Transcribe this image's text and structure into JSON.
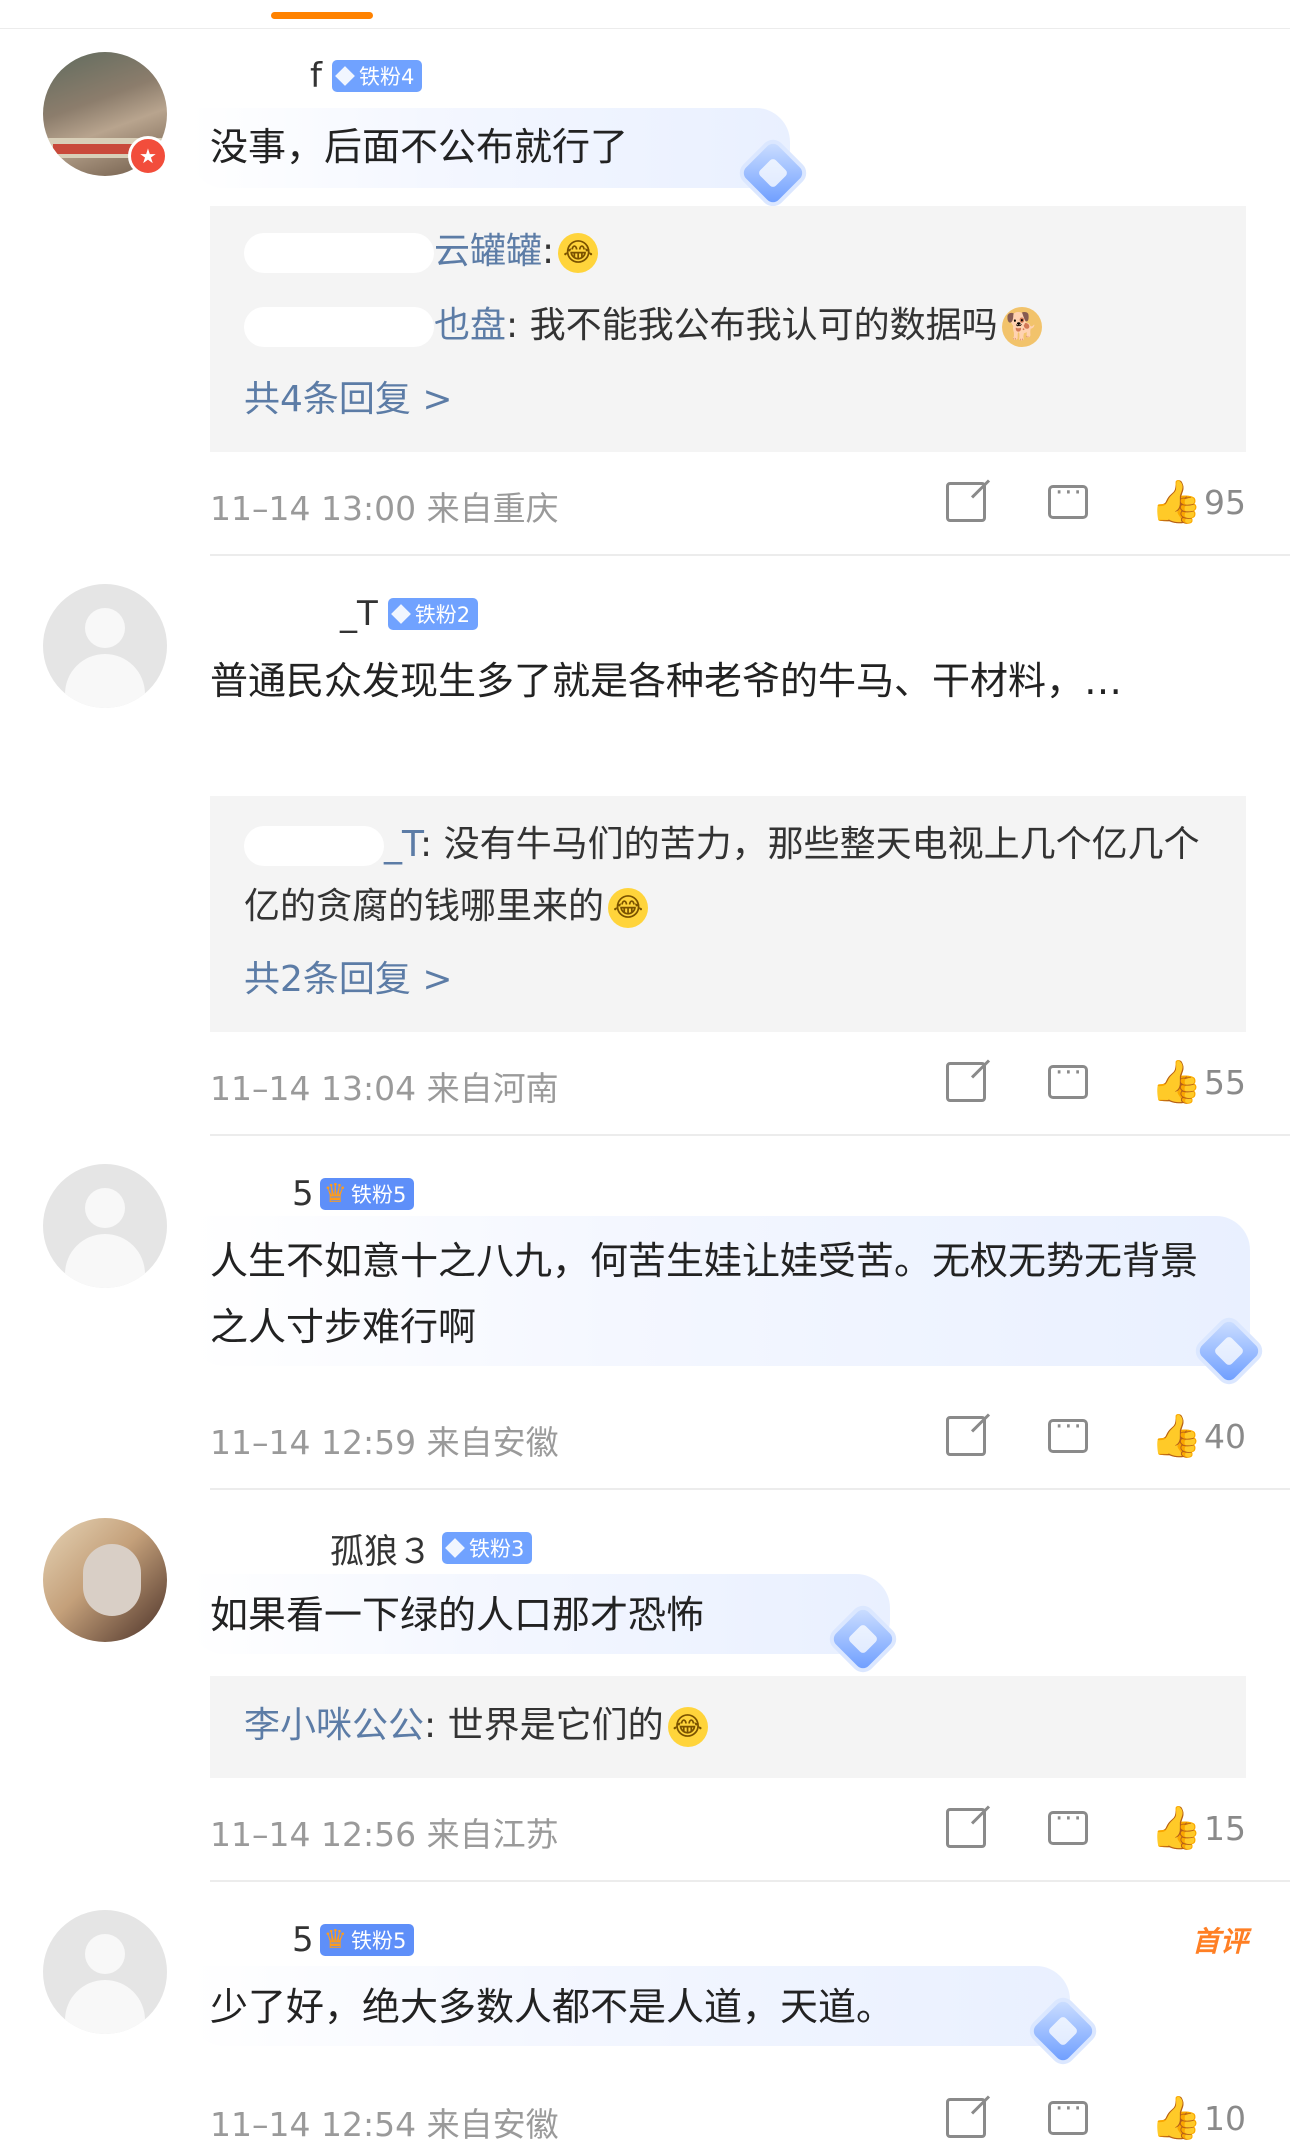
{
  "comments": [
    {
      "username": "f",
      "fan_badge": "铁粉4",
      "text": "没事，后面不公布就行了",
      "replies": [
        {
          "name": "云罐罐",
          "sep": ":",
          "content": ""
        },
        {
          "name": "也盘",
          "sep": ":",
          "content": "我不能我公布我认可的数据吗"
        }
      ],
      "more_replies": "共4条回复 >",
      "time": "11–14 13:00",
      "location": "来自重庆",
      "likes": "95"
    },
    {
      "username": "_T",
      "fan_badge": "铁粉2",
      "text": "普通民众发现生多了就是各种老爷的牛马、干材料，…",
      "replies": [
        {
          "name": "_T",
          "sep": ":",
          "content": "没有牛马们的苦力，那些整天电视上几个亿几个亿的贪腐的钱哪里来的"
        }
      ],
      "more_replies": "共2条回复 >",
      "time": "11–14 13:04",
      "location": "来自河南",
      "likes": "55"
    },
    {
      "username": "5",
      "fan_badge": "铁粉5",
      "text": "人生不如意十之八九，何苦生娃让娃受苦。无权无势无背景之人寸步难行啊",
      "time": "11–14 12:59",
      "location": "来自安徽",
      "likes": "40"
    },
    {
      "username": "孤狼３",
      "fan_badge": "铁粉3",
      "text": "如果看一下绿的人口那才恐怖",
      "replies": [
        {
          "name": "李小咪公公",
          "sep": ":",
          "content": "世界是它们的"
        }
      ],
      "time": "11–14 12:56",
      "location": "来自江苏",
      "likes": "15"
    },
    {
      "username": "5",
      "fan_badge": "铁粉5",
      "first_badge": "首评",
      "text": "少了好，绝大多数人都不是人道，天道。",
      "time": "11–14 12:54",
      "location": "来自安徽",
      "likes": "10"
    }
  ],
  "icons": [
    "share-icon",
    "comment-icon",
    "like-icon",
    "fan-diamond-icon",
    "crown-icon",
    "laugh-cry-emoji",
    "doge-emoji",
    "verified-star-icon"
  ],
  "colors": {
    "accent": "#ff8200",
    "link": "#5c7ca6",
    "fan_badge": "#70a2ff",
    "meta": "#9a9a9a"
  }
}
